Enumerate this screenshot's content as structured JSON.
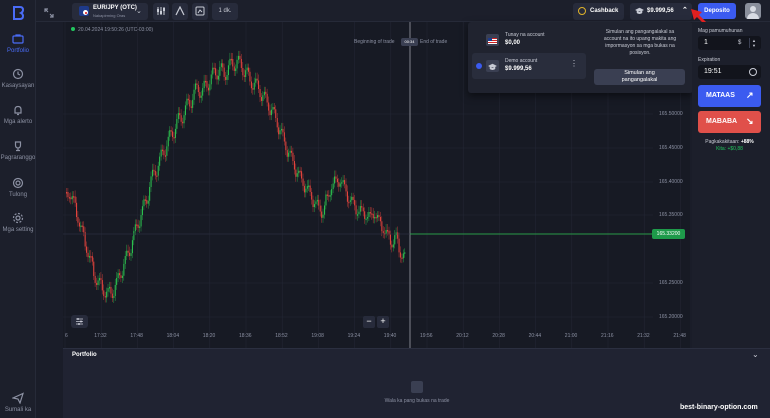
{
  "sidebar": {
    "items": [
      {
        "label": "Portfolio",
        "icon": "briefcase-icon",
        "active": true
      },
      {
        "label": "Kasaysayan",
        "icon": "history-icon"
      },
      {
        "label": "Mga alerto",
        "icon": "bell-icon"
      },
      {
        "label": "Pagraranggo",
        "icon": "trophy-icon"
      },
      {
        "label": "Tulong",
        "icon": "help-icon"
      },
      {
        "label": "Mga setting",
        "icon": "gear-icon"
      }
    ],
    "bottom": {
      "label": "Sumali ka",
      "icon": "send-icon"
    }
  },
  "topbar": {
    "asset_name": "EUR/JPY (OTC)",
    "asset_sub": "Nakapirming Oras",
    "timeframe": "1 dk.",
    "cashback_label": "Cashback",
    "balance": "$9.999,56",
    "deposit_label": "Deposito"
  },
  "chart": {
    "datetime": "20.04.2024  19:50:26 (UTC-03:00)",
    "beginning_label": "Beginning of trade",
    "timer": "00:34",
    "end_label": "End of trade",
    "current_price": "165.33200",
    "y_ticks": [
      "165.50000",
      "165.45000",
      "165.40000",
      "165.35000",
      "165.30000",
      "165.25000",
      "165.20000"
    ],
    "x_ticks": [
      "6",
      "17:32",
      "17:48",
      "18:04",
      "18:20",
      "18:36",
      "18:52",
      "19:08",
      "19:24",
      "19:40",
      "19:56",
      "20:12",
      "20:28",
      "20:44",
      "21:00",
      "21:16",
      "21:32",
      "21:48"
    ],
    "colors": {
      "up": "#2bbf4e",
      "down": "#e0433c",
      "price_line": "#2bbf4e"
    }
  },
  "account_menu": {
    "real_label": "Tunay na account",
    "real_value": "$0,00",
    "demo_label": "Demo account",
    "demo_value": "$9.999,56",
    "info_line1": "Simulan ang pangangalakal sa",
    "info_line2": "account na ito upang makita ang",
    "info_line3": "impormasyon sa mga bukas na",
    "info_line4": "posisyon.",
    "start_line1": "Simulan ang",
    "start_line2": "pangangalakal"
  },
  "panel": {
    "amount_label": "Mag pamumuhunan",
    "amount": "1",
    "currency": "$",
    "expiration_label": "Expiration",
    "expiration": "19:51",
    "up_label": "MATAAS",
    "down_label": "MABABA",
    "payout_label": "Pagkakakitaan: ",
    "payout_value": "+88%",
    "profit_label": "Kita: ",
    "profit_value": "+$0,88"
  },
  "portfolio": {
    "title": "Portfolio",
    "empty": "Wala ka pang bukas na trade"
  },
  "watermark": "best-binary-option.com"
}
